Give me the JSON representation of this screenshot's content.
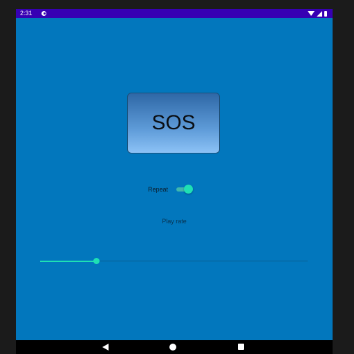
{
  "status_bar": {
    "time": "2:31",
    "icons": [
      "app-notification-icon",
      "wifi-icon",
      "signal-icon",
      "battery-icon"
    ]
  },
  "sos_button": {
    "label": "SOS"
  },
  "repeat": {
    "label": "Repeat",
    "enabled": true
  },
  "play_rate": {
    "label": "Play rate",
    "value_fraction": 0.21
  },
  "nav_bar": {
    "icons": [
      "back-icon",
      "home-icon",
      "recents-icon"
    ]
  },
  "colors": {
    "app_background": "#0277bd",
    "status_bar": "#3700b3",
    "accent": "#1ee0b4",
    "frame": "#1b1b1b",
    "nav_bar": "#000000"
  }
}
